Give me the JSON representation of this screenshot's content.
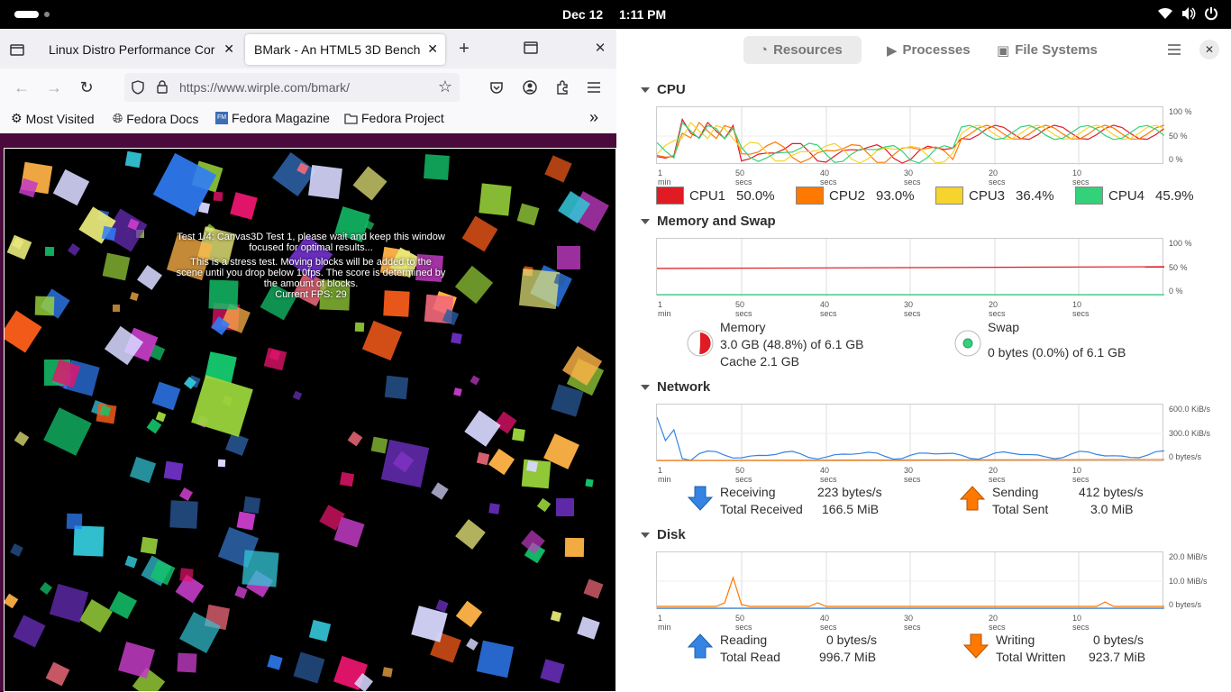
{
  "topbar": {
    "date": "Dec 12",
    "time": "1:11 PM"
  },
  "browser": {
    "tabs": [
      {
        "label": "Linux Distro Performance Cor"
      },
      {
        "label": "BMark - An HTML5 3D Bench"
      }
    ],
    "url": "https://www.wirple.com/bmark/",
    "bookmarks": [
      "Most Visited",
      "Fedora Docs",
      "Fedora Magazine",
      "Fedora Project"
    ],
    "overlay": {
      "line1": "Test 1/4: Canvas3D Test 1, please wait and keep this window focused for optimal results...",
      "line2": "This is a stress test. Moving blocks will be added to the scene until you drop below 10fps. The score is determined by the amount of blocks.",
      "fps": "Current FPS: 29"
    }
  },
  "monitor": {
    "tabs": [
      "Resources",
      "Processes",
      "File Systems"
    ],
    "time_labels": [
      "1 min",
      "50 secs",
      "40 secs",
      "30 secs",
      "20 secs",
      "10 secs"
    ],
    "cpu": {
      "title": "CPU",
      "y_labels": [
        "100 %",
        "50 %",
        "0 %"
      ],
      "legend": [
        {
          "name": "CPU1",
          "value": "50.0%",
          "color": "#e01b24"
        },
        {
          "name": "CPU2",
          "value": "93.0%",
          "color": "#ff7800"
        },
        {
          "name": "CPU3",
          "value": "36.4%",
          "color": "#f6d32d"
        },
        {
          "name": "CPU4",
          "value": "45.9%",
          "color": "#33d17a"
        }
      ]
    },
    "memory": {
      "title": "Memory and Swap",
      "y_labels": [
        "100 %",
        "50 %",
        "0 %"
      ],
      "mem_label": "Memory",
      "mem_used": "3.0 GB (48.8%) of 6.1 GB",
      "mem_cache": "Cache 2.1 GB",
      "swap_label": "Swap",
      "swap_used": "0 bytes (0.0%) of 6.1 GB"
    },
    "network": {
      "title": "Network",
      "y_labels": [
        "600.0 KiB/s",
        "300.0 KiB/s",
        "0 bytes/s"
      ],
      "recv_label": "Receiving",
      "recv_value": "223 bytes/s",
      "total_recv_label": "Total Received",
      "total_recv_value": "166.5 MiB",
      "send_label": "Sending",
      "send_value": "412 bytes/s",
      "total_sent_label": "Total Sent",
      "total_sent_value": "3.0 MiB"
    },
    "disk": {
      "title": "Disk",
      "y_labels": [
        "20.0 MiB/s",
        "10.0 MiB/s",
        "0 bytes/s"
      ],
      "read_label": "Reading",
      "read_value": "0 bytes/s",
      "total_read_label": "Total Read",
      "total_read_value": "996.7 MiB",
      "write_label": "Writing",
      "write_value": "0 bytes/s",
      "total_write_label": "Total Written",
      "total_write_value": "923.7 MiB"
    }
  }
}
